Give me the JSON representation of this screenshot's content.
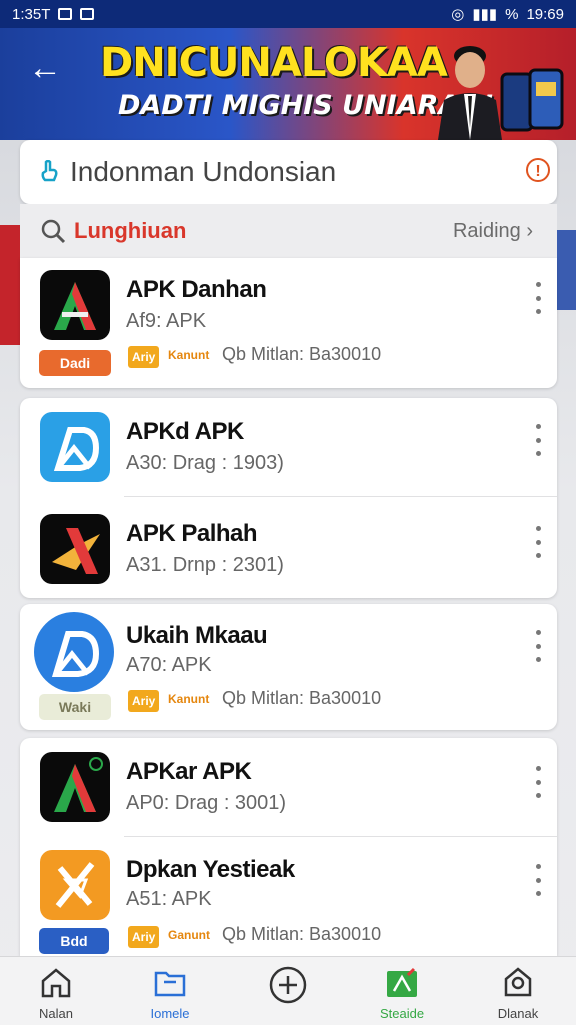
{
  "status_bar": {
    "time_left": "1:35T",
    "battery": "%",
    "time_right": "19:69"
  },
  "header": {
    "banner_title": "DNICUNALOKAA",
    "banner_subtitle": "DADTI MIGHIS UNIARAN!"
  },
  "search_card": {
    "title": "Indonman Undonsian"
  },
  "filter": {
    "query": "Lunghiuan",
    "sort_label": "Raiding"
  },
  "apps": [
    {
      "name": "APK Danhan",
      "meta": "Af9: APK",
      "badge": "Dadi",
      "tag": "Ariy",
      "tag_text": "Kanunt",
      "tag_rest": "Qb Mitlan: Ba30010"
    },
    {
      "name": "APKd APK",
      "meta": "A30: Drag : 1903)"
    },
    {
      "name": "APK Palhah",
      "meta": "A31. Drnp : 2301)"
    },
    {
      "name": "Ukaih Mkaau",
      "meta": "A70: APK",
      "badge": "Waki",
      "tag": "Ariy",
      "tag_text": "Kanunt",
      "tag_rest": "Qb Mitlan: Ba30010"
    },
    {
      "name": "APKar APK",
      "meta": "AP0: Drag : 3001)"
    },
    {
      "name": "Dpkan Yestieak",
      "meta": "A51: APK",
      "badge": "Bdd",
      "tag": "Ariy",
      "tag_text": "Ganunt",
      "tag_rest": "Qb Mitlan: Ba30010"
    }
  ],
  "bottom_nav": [
    {
      "label": "Nalan",
      "icon": "home-icon"
    },
    {
      "label": "Iomele",
      "icon": "folder-icon"
    },
    {
      "label": "",
      "icon": "add-icon"
    },
    {
      "label": "Steaide",
      "icon": "store-icon"
    },
    {
      "label": "Dlanak",
      "icon": "profile-icon"
    }
  ],
  "colors": {
    "accent": "#d9372b",
    "nav_active": "#2a6fd6",
    "tag": "#f2a81d",
    "header_blue": "#1b3f9c"
  }
}
